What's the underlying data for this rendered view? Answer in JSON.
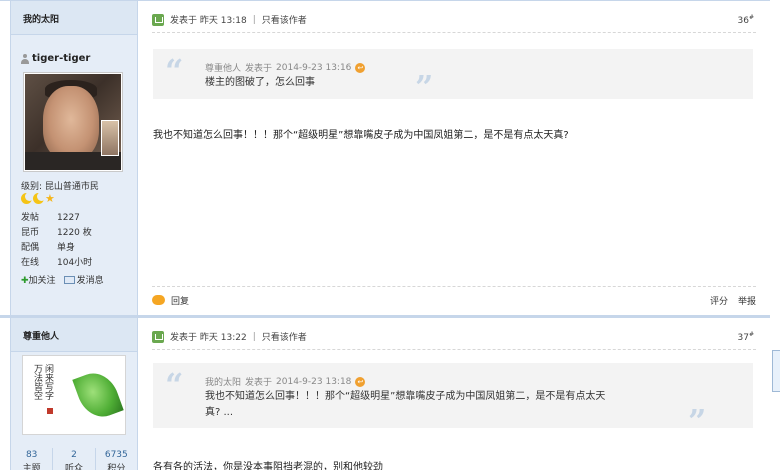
{
  "post1": {
    "sidebar_title": "我的太阳",
    "username": "tiger-tiger",
    "level": "级别: 昆山普通市民",
    "stats": [
      {
        "key": "发帖",
        "value": "1227"
      },
      {
        "key": "昆币",
        "value": "1220 枚"
      },
      {
        "key": "配偶",
        "value": "单身"
      },
      {
        "key": "在线",
        "value": "104小时"
      }
    ],
    "follow_label": "加关注",
    "message_label": "发消息",
    "posted_label": "发表于",
    "posted_time": "昨天 13:18",
    "only_author": "只看该作者",
    "floor": "36",
    "floor_sup": "#",
    "quote_author": "尊重他人",
    "quote_posted_label": "发表于",
    "quote_time": "2014-9-23 13:16",
    "quote_text": "楼主的图破了，怎么回事",
    "body": "我也不知道怎么回事！！！那个“超级明星”想靠嘴皮子成为中国凤姐第二，是不是有点太天真?",
    "reply_label": "回复",
    "rate_label": "评分",
    "report_label": "举报"
  },
  "post2": {
    "sidebar_title": "尊重他人",
    "posted_label": "发表于",
    "posted_time": "昨天 13:22",
    "only_author": "只看该作者",
    "floor": "37",
    "floor_sup": "#",
    "quote_author": "我的太阳",
    "quote_posted_label": "发表于",
    "quote_time": "2014-9-23 13:18",
    "quote_line1": "我也不知道怎么回事！！！那个“超级明星”想靠嘴皮子成为中国凤姐第二，是不是有点太天",
    "quote_line2": "真? ...",
    "body": "各有各的活法，你是没本事阻挡老混的，别和他较劲",
    "user_stats": [
      {
        "value": "83",
        "label": "主题"
      },
      {
        "value": "2",
        "label": "听众"
      },
      {
        "value": "6735",
        "label": "积分"
      }
    ]
  },
  "colors": {
    "sidebar_bg": "#e5edf7",
    "border": "#c6d6ea",
    "quote_bg": "#f3f3f3",
    "accent_orange": "#f5a623",
    "accent_green": "#6aa84f"
  }
}
